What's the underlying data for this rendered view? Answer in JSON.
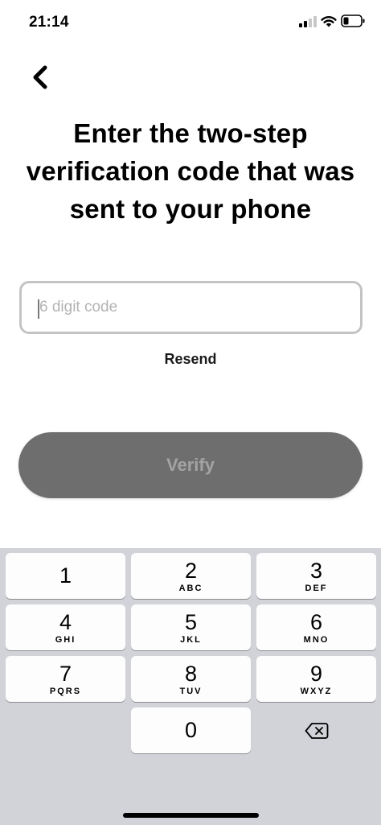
{
  "status_bar": {
    "time": "21:14",
    "icons": [
      "signal-icon",
      "wifi-icon",
      "battery-icon"
    ]
  },
  "navigation": {
    "back_icon": "chevron-left-icon"
  },
  "main": {
    "title": "Enter the two-step verification code that was sent to your phone",
    "code_input": {
      "placeholder": "6 digit code",
      "value": ""
    },
    "resend_label": "Resend",
    "verify_label": "Verify"
  },
  "keyboard": {
    "keys": [
      {
        "digit": "1",
        "letters": ""
      },
      {
        "digit": "2",
        "letters": "ABC"
      },
      {
        "digit": "3",
        "letters": "DEF"
      },
      {
        "digit": "4",
        "letters": "GHI"
      },
      {
        "digit": "5",
        "letters": "JKL"
      },
      {
        "digit": "6",
        "letters": "MNO"
      },
      {
        "digit": "7",
        "letters": "PQRS"
      },
      {
        "digit": "8",
        "letters": "TUV"
      },
      {
        "digit": "9",
        "letters": "WXYZ"
      },
      {
        "digit": "0",
        "letters": ""
      }
    ],
    "delete_icon": "backspace-icon"
  },
  "colors": {
    "verify_button_bg": "#6e6e6e",
    "verify_button_text": "#a3a3a3",
    "input_border": "#c4c4c4",
    "keyboard_bg": "#d1d3d9"
  }
}
